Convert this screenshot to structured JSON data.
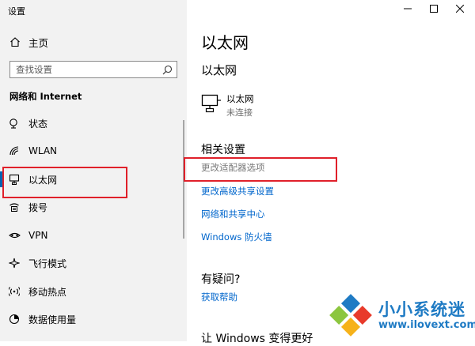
{
  "window": {
    "title": "设置",
    "controls": [
      "minimize",
      "maximize",
      "close"
    ]
  },
  "sidebar": {
    "home_label": "主页",
    "search": {
      "placeholder": "查找设置"
    },
    "section_title": "网络和 Internet",
    "items": [
      {
        "label": "状态",
        "icon": "status-icon"
      },
      {
        "label": "WLAN",
        "icon": "wifi-icon"
      },
      {
        "label": "以太网",
        "icon": "ethernet-icon",
        "selected": true
      },
      {
        "label": "拨号",
        "icon": "dialup-icon"
      },
      {
        "label": "VPN",
        "icon": "vpn-icon"
      },
      {
        "label": "飞行模式",
        "icon": "airplane-icon"
      },
      {
        "label": "移动热点",
        "icon": "hotspot-icon"
      },
      {
        "label": "数据使用量",
        "icon": "data-usage-icon"
      }
    ]
  },
  "main": {
    "page_title": "以太网",
    "sub_title": "以太网",
    "device": {
      "name": "以太网",
      "status": "未连接"
    },
    "related_settings": {
      "heading": "相关设置",
      "links": [
        "更改适配器选项",
        "更改高级共享设置",
        "网络和共享中心",
        "Windows 防火墙"
      ]
    },
    "faq": {
      "heading": "有疑问?",
      "link": "获取帮助"
    },
    "improve_heading": "让 Windows 变得更好"
  },
  "watermark": {
    "text_cn": "小小系统迷",
    "url": "www.ilovext.com",
    "colors": [
      "#1f7bc4",
      "#e83a2b",
      "#8cc63f",
      "#f6b21a"
    ]
  },
  "annotation_color": "#e0202a",
  "accent_color": "#0063b1",
  "link_color": "#0066cc"
}
